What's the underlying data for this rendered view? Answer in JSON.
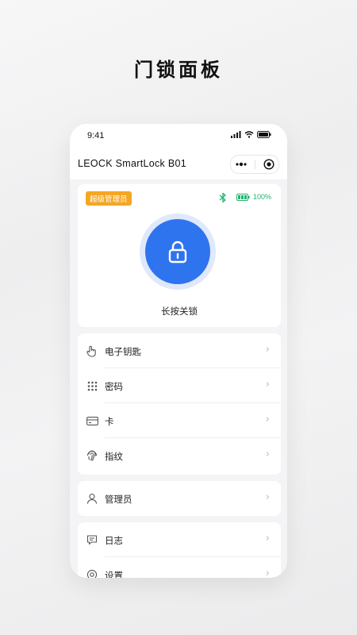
{
  "headline": "门锁面板",
  "status_bar": {
    "time": "9:41"
  },
  "nav": {
    "title": "LEOCK SmartLock B01"
  },
  "lock_panel": {
    "role_badge": "超级管理员",
    "battery": "100%",
    "lock_label": "长按关锁",
    "accent_color": "#2f74ef",
    "battery_color": "#23b26d",
    "badge_color": "#f5a623"
  },
  "menu_group1": [
    {
      "label": "电子钥匙",
      "icon": "hand-pointer-icon"
    },
    {
      "label": "密码",
      "icon": "keypad-icon"
    },
    {
      "label": "卡",
      "icon": "card-icon"
    },
    {
      "label": "指纹",
      "icon": "fingerprint-icon"
    }
  ],
  "menu_group2": [
    {
      "label": "管理员",
      "icon": "user-icon"
    }
  ],
  "menu_group3": [
    {
      "label": "日志",
      "icon": "message-icon"
    },
    {
      "label": "设置",
      "icon": "settings-icon"
    }
  ],
  "chevron": "›"
}
